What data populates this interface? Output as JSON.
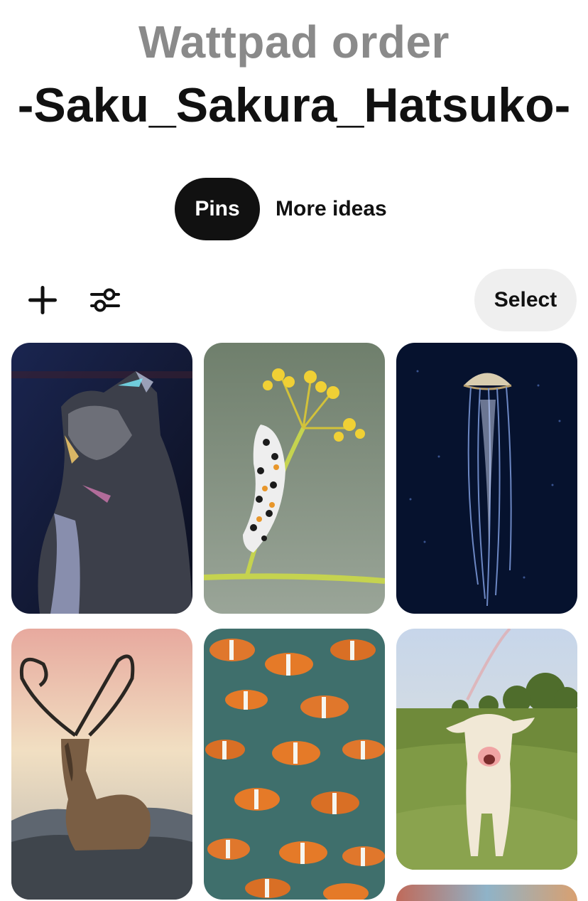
{
  "board": {
    "subtitle": "Wattpad order",
    "title": "-Saku_Sakura_Hatsuko-"
  },
  "tabs": [
    {
      "label": "Pins",
      "active": true
    },
    {
      "label": "More ideas",
      "active": false
    }
  ],
  "toolbar": {
    "add_icon": "plus-icon",
    "filter_icon": "sliders-icon",
    "select_label": "Select"
  },
  "pins": [
    {
      "subject": "cat"
    },
    {
      "subject": "caterpillar"
    },
    {
      "subject": "jellyfish"
    },
    {
      "subject": "deer"
    },
    {
      "subject": "clownfish"
    },
    {
      "subject": "calf"
    },
    {
      "subject": "partial"
    }
  ],
  "colors": {
    "active_tab_bg": "#111111",
    "select_button_bg": "#efefef",
    "subtitle": "#8a8a8a"
  }
}
